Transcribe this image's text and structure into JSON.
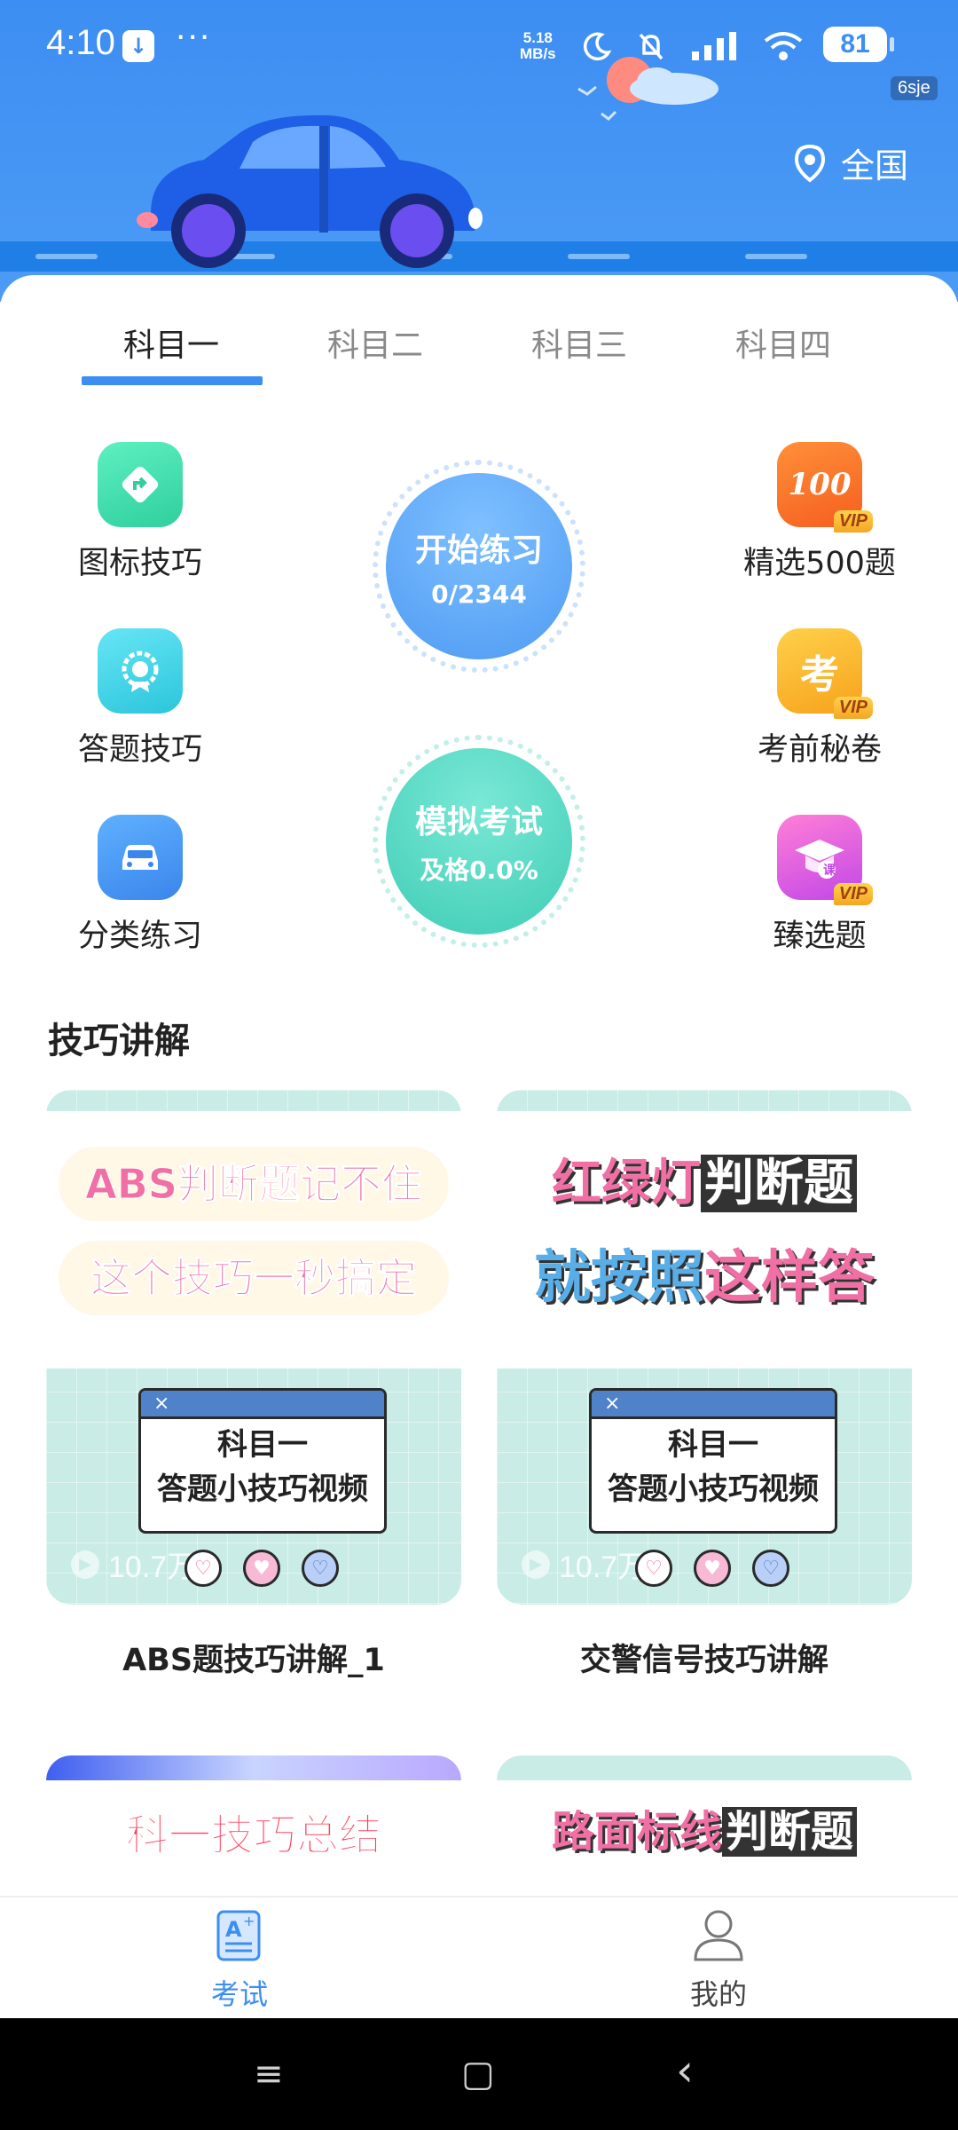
{
  "status_bar": {
    "time": "4:10",
    "more": "···",
    "speed_value": "5.18",
    "speed_unit": "MB/s",
    "battery": "81",
    "badge": "6sje"
  },
  "header": {
    "location_label": "全国"
  },
  "tabs": [
    {
      "label": "科目一",
      "active": true
    },
    {
      "label": "科目二",
      "active": false
    },
    {
      "label": "科目三",
      "active": false
    },
    {
      "label": "科目四",
      "active": false
    }
  ],
  "features_left": [
    {
      "label": "图标技巧",
      "icon": "direction-sign-icon"
    },
    {
      "label": "答题技巧",
      "icon": "badge-flower-icon"
    },
    {
      "label": "分类练习",
      "icon": "car-icon"
    }
  ],
  "features_right": [
    {
      "label": "精选500题",
      "icon": "hundred-score-icon",
      "vip": "VIP",
      "glyph": "100"
    },
    {
      "label": "考前秘卷",
      "icon": "exam-character-icon",
      "vip": "VIP",
      "glyph": "考"
    },
    {
      "label": "臻选题",
      "icon": "graduation-cap-icon",
      "vip": "VIP",
      "glyph": "课"
    }
  ],
  "practice": {
    "label": "开始练习",
    "progress": "0/2344"
  },
  "mock_exam": {
    "label": "模拟考试",
    "pass_rate": "及格0.0%"
  },
  "section_title": "技巧讲解",
  "videos": [
    {
      "line1": "ABS判断题记不住",
      "line2": "这个技巧一秒搞定",
      "window_title_1": "科目一",
      "window_title_2": "答题小技巧视频",
      "close": "×",
      "views": "10.7万",
      "title": "ABS题技巧讲解_1"
    },
    {
      "line1a": "红绿灯",
      "line1b": "判断题",
      "line2a": "就按照",
      "line2b": "这样答",
      "window_title_1": "科目一",
      "window_title_2": "答题小技巧视频",
      "close": "×",
      "views": "10.7万",
      "title": "交警信号技巧讲解"
    }
  ],
  "videos_row2": [
    {
      "text": "科一技巧总结"
    },
    {
      "text_a": "路面标线",
      "text_b": "判断题"
    }
  ],
  "bottom_nav": [
    {
      "label": "考试",
      "active": true,
      "icon": "exam-paper-icon"
    },
    {
      "label": "我的",
      "active": false,
      "icon": "user-profile-icon"
    }
  ],
  "system_nav": {
    "menu": "≡",
    "home": "▢",
    "back": "‹"
  },
  "colors": {
    "primary": "#3d8ef2",
    "practice_circle": "#5ea6f6",
    "exam_circle": "#4fd4c0",
    "pink": "#f06fa4",
    "tab_inactive": "#8a8a8a"
  }
}
